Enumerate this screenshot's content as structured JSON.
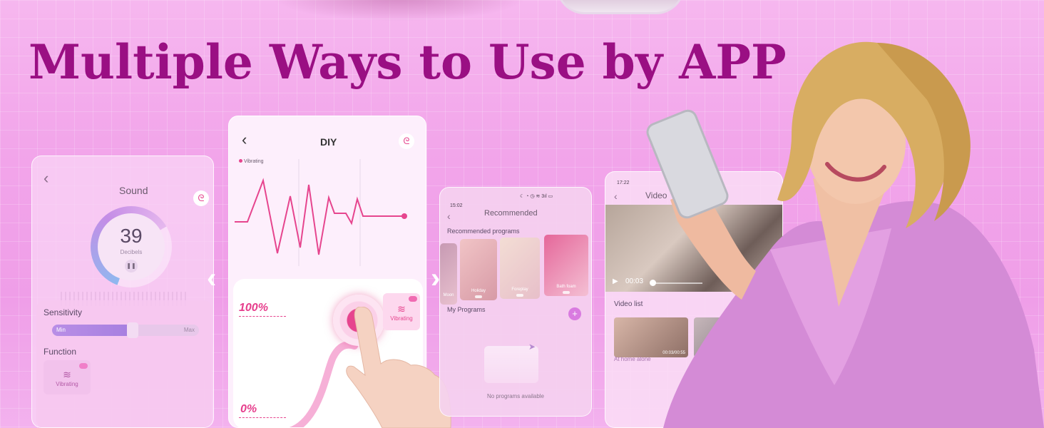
{
  "headline": "Multiple Ways to Use by APP",
  "colors": {
    "headline": "#9a0f83",
    "accent_pink": "#e6458e",
    "background": "#f2a5ea",
    "dress": "#d58ad8",
    "hair": "#d4a65a"
  },
  "sound_screen": {
    "back_icon": "chevron-left-icon",
    "title": "Sound",
    "logo_icon": "app-logo-icon",
    "gauge_value": "39",
    "gauge_unit": "Decibels",
    "pause_icon": "pause-icon",
    "sensitivity_label": "Sensitivity",
    "slider_min": "Min",
    "slider_max": "Max",
    "slider_level": 0.55,
    "function_label": "Function",
    "function_tile_label": "Vibrating",
    "function_tile_icon": "vibrate-waves-icon"
  },
  "diy_screen": {
    "back_icon": "chevron-left-icon",
    "title": "DIY",
    "logo_icon": "app-logo-icon",
    "legend": "Vibrating",
    "top_label": "100%",
    "bottom_label": "0%",
    "ring_label": "Vibrating",
    "tile_label": "Vibrating",
    "tile_icon": "vibrate-waves-icon"
  },
  "carousel": {
    "prev_icon": "chevron-left-icon",
    "next_icon": "chevron-right-icon"
  },
  "recommended_screen": {
    "status_time": "15:02",
    "status_icons": "☾ ◔ ◷ ≋ 3ıl ▭",
    "back_icon": "chevron-left-icon",
    "title": "Recommended",
    "section_title": "Recommended programs",
    "programs": [
      {
        "label": "Moon"
      },
      {
        "label": "Holiday"
      },
      {
        "label": "Foreplay"
      },
      {
        "label": "Bath foam"
      }
    ],
    "my_programs_label": "My Programs",
    "add_icon": "plus-icon",
    "empty_text": "No programs available"
  },
  "video_screen": {
    "status_time": "17:22",
    "back_icon": "chevron-left-icon",
    "title": "Video",
    "play_icon": "play-icon",
    "current_time": "00:03",
    "progress": 0.05,
    "volume_icon": "volume-icon",
    "list_title": "Video list",
    "items": [
      {
        "caption": "At home alone",
        "duration": "00:03/00:55"
      }
    ]
  }
}
